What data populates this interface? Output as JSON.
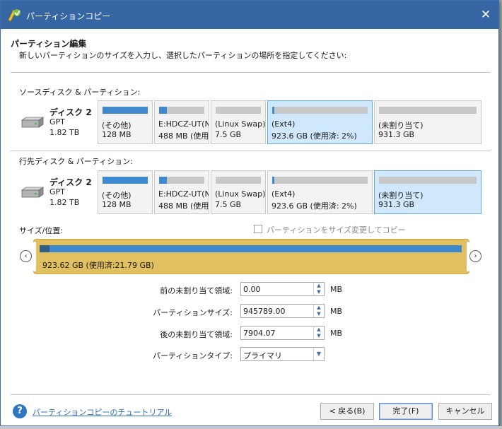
{
  "window": {
    "title": "パーティションコピー",
    "close_glyph": "✕"
  },
  "header": {
    "title": "パーティション編集",
    "subtitle": "新しいパーティションのサイズを入力し、選択したパーティションの場所を指定してください:"
  },
  "source": {
    "label": "ソースディスク & パーティション:",
    "disk": {
      "name": "ディスク 2",
      "type": "GPT",
      "size": "1.82 TB"
    },
    "partitions": [
      {
        "label": "(その他)",
        "size": "128 MB",
        "used_fraction": 1.0,
        "selected": false
      },
      {
        "label": "E:HDCZ-UT(N",
        "size": "488 MB (使用",
        "used_fraction": 0.17,
        "selected": false
      },
      {
        "label": "(Linux Swap)",
        "size": "7.5 GB",
        "used_fraction": 0.0,
        "selected": false
      },
      {
        "label": "(Ext4)",
        "size": "923.6 GB (使用済: 2%)",
        "used_fraction": 0.02,
        "selected": true
      },
      {
        "label": "(未割り当て)",
        "size": "931.3 GB",
        "used_fraction": 0.0,
        "selected": false
      }
    ]
  },
  "target": {
    "label": "行先ディスク & パーティション:",
    "disk": {
      "name": "ディスク 2",
      "type": "GPT",
      "size": "1.82 TB"
    },
    "partitions": [
      {
        "label": "(その他)",
        "size": "128 MB",
        "used_fraction": 1.0,
        "selected": false
      },
      {
        "label": "E:HDCZ-UT(N",
        "size": "488 MB (使用",
        "used_fraction": 0.17,
        "selected": false
      },
      {
        "label": "(Linux Swap)",
        "size": "7.5 GB",
        "used_fraction": 0.0,
        "selected": false
      },
      {
        "label": "(Ext4)",
        "size": "923.6 GB (使用済: 2%)",
        "used_fraction": 0.02,
        "selected": false
      },
      {
        "label": "(未割り当て)",
        "size": "931.3 GB",
        "used_fraction": 0.0,
        "selected": true
      }
    ]
  },
  "size_position": {
    "label": "サイズ/位置:",
    "resize_checkbox_label": "パーティションをサイズ変更してコピー",
    "resize_checked": false,
    "slider_text": "923.62 GB (使用済:21.79 GB)",
    "used_fraction": 0.024,
    "left_arrow": "‹",
    "right_arrow": "›"
  },
  "form": {
    "before_label": "前の未割り当て領域:",
    "before_value": "0.00",
    "before_unit": "MB",
    "size_label": "パーティションサイズ:",
    "size_value": "945789.00",
    "size_unit": "MB",
    "after_label": "後の未割り当て領域:",
    "after_value": "7904.07",
    "after_unit": "MB",
    "type_label": "パーティションタイプ:",
    "type_value": "プライマリ"
  },
  "footer": {
    "help_glyph": "?",
    "help_link": "パーティションコピーのチュートリアル",
    "back_button": "< 戻る(B)",
    "finish_button": "完了(F)",
    "cancel_button": "キャンセル"
  },
  "colors": {
    "titlebar": "#3766a4",
    "bar_used": "#3e89cf",
    "bar_empty": "#c8c8c8",
    "selected_partition": "#cfe8fc",
    "slider_bg": "#e0c060",
    "link": "#2a6fc1"
  }
}
